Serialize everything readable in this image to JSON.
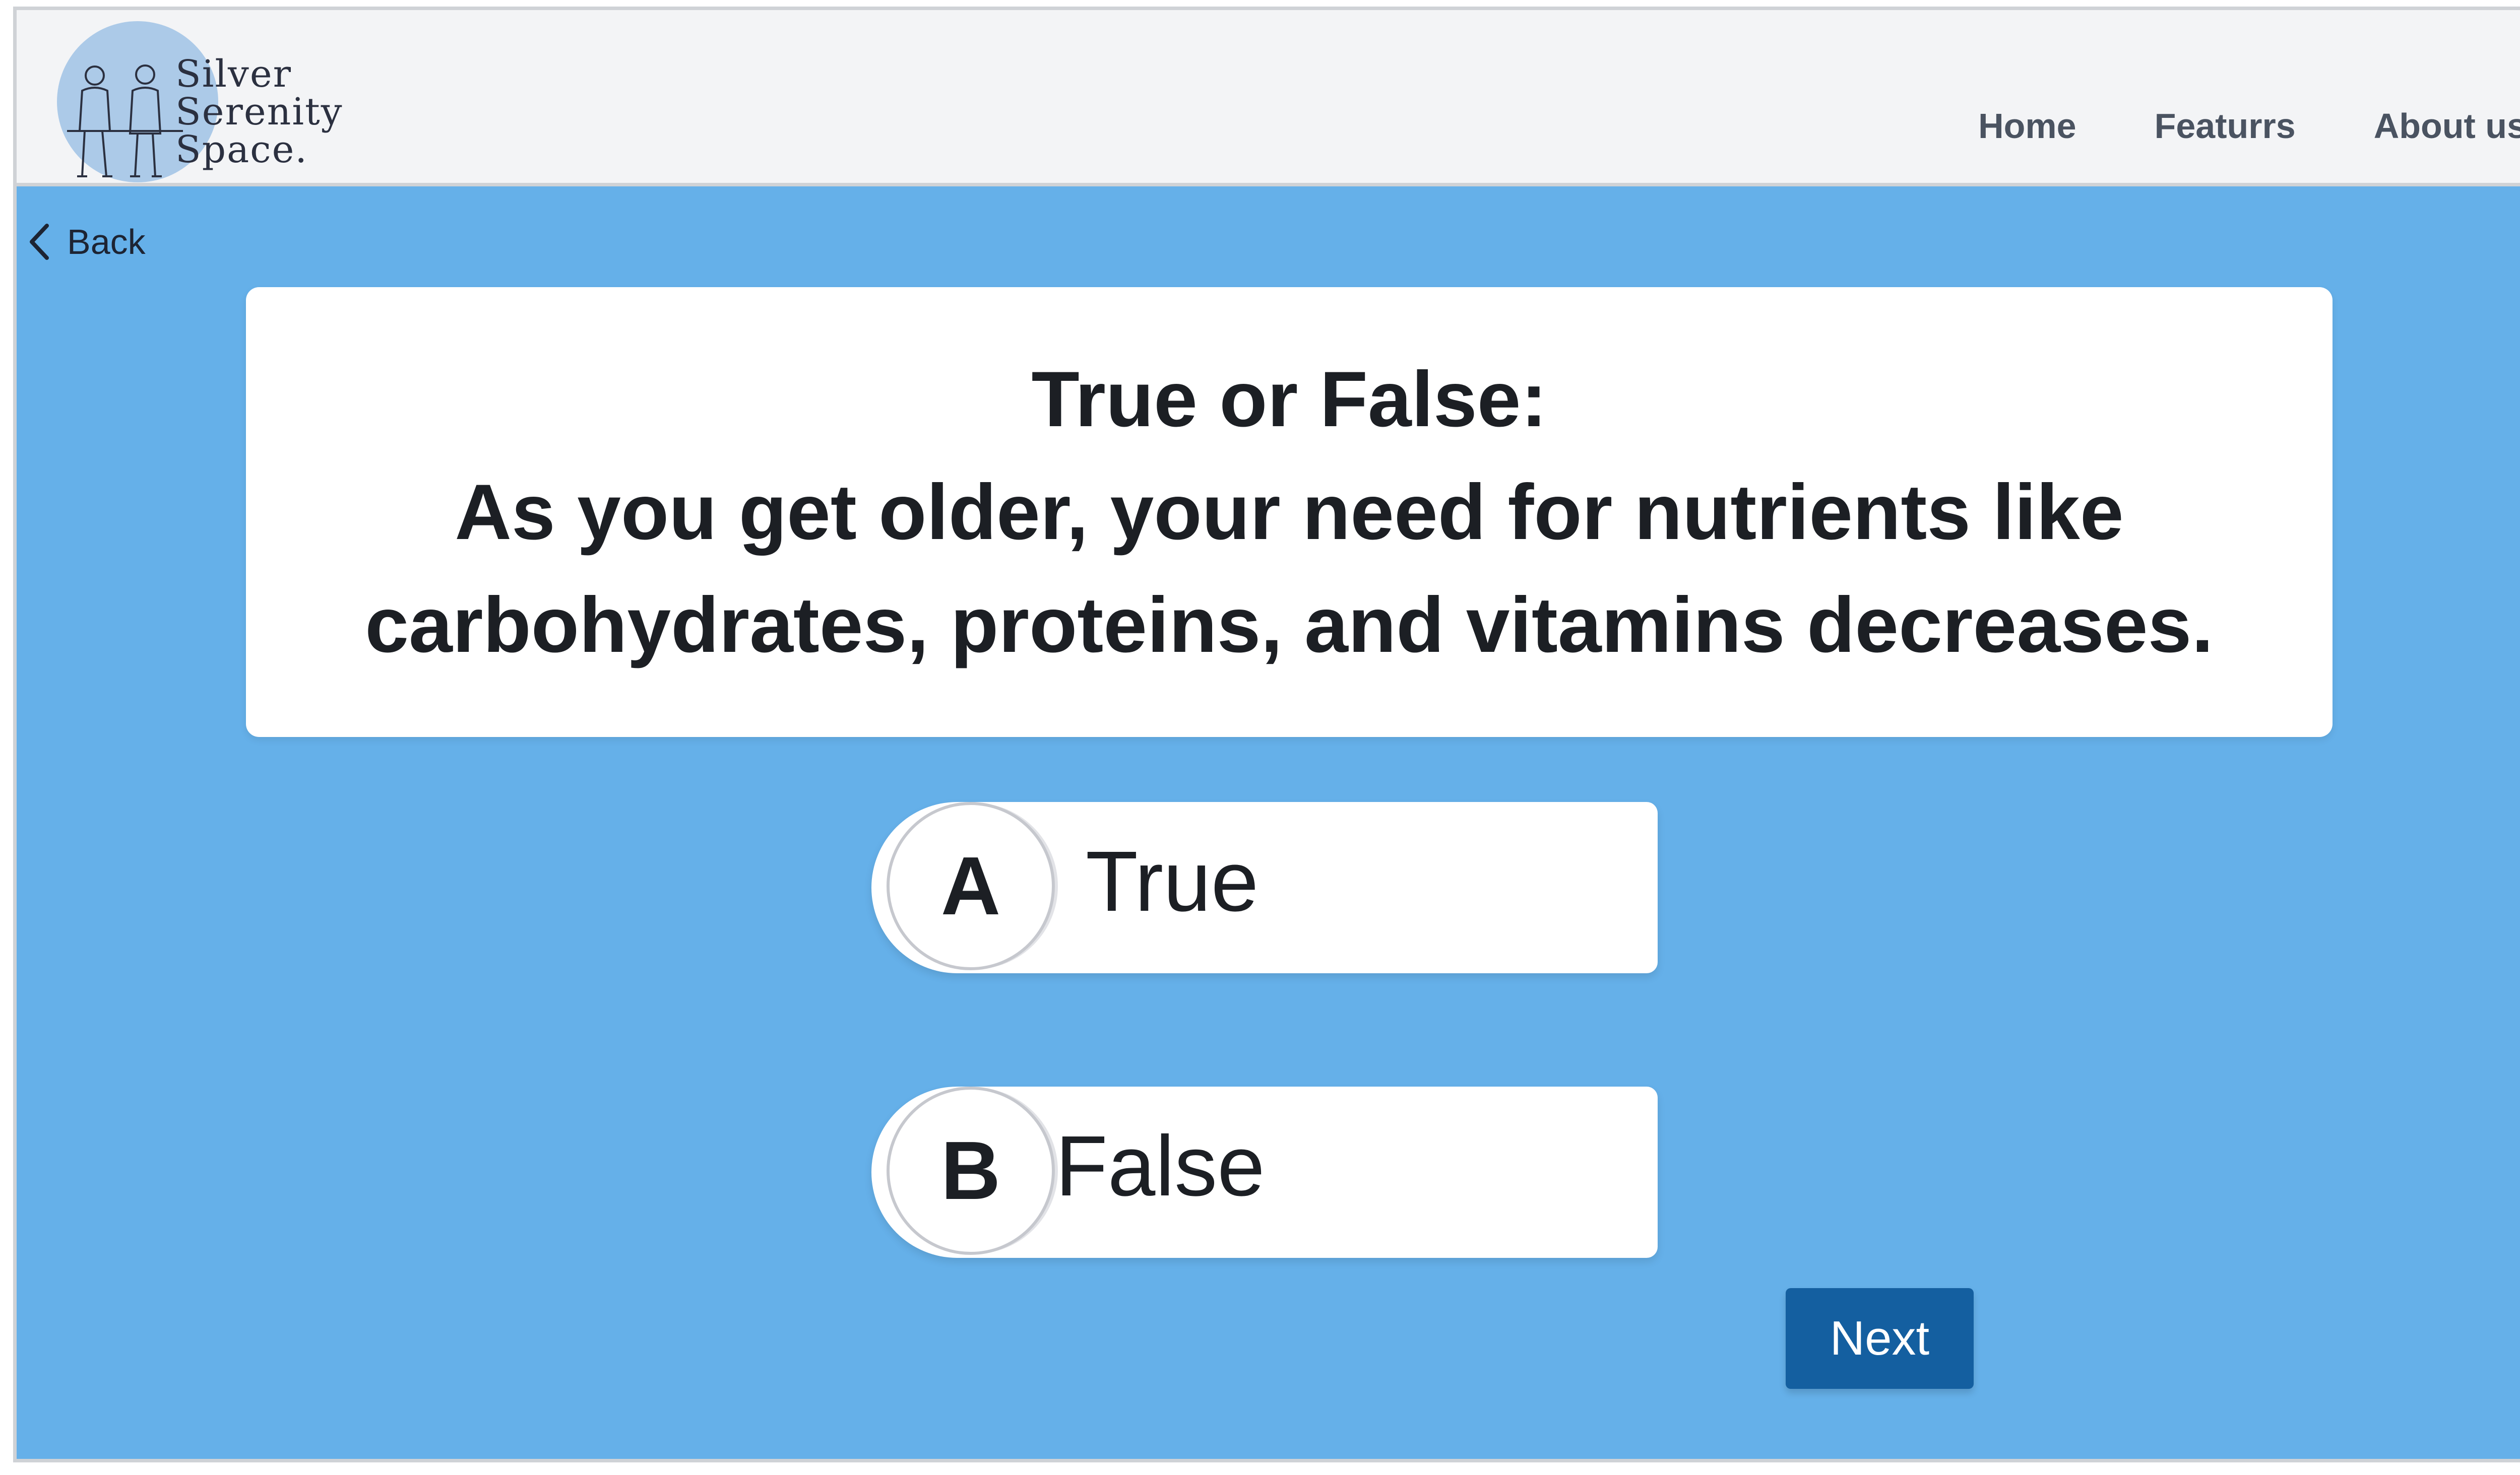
{
  "brand": {
    "lines": [
      "Silver",
      "Serenity",
      "Space."
    ],
    "logo_circle_color": "#9fc2e5"
  },
  "nav": {
    "items": [
      "Home",
      "Featurrs",
      "About us"
    ]
  },
  "back": {
    "label": "Back",
    "icon": "chevron-left-icon"
  },
  "question": {
    "title": "True or False:",
    "text": "As you get older, your need for nutrients like carbohydrates, proteins, and vitamins decreases."
  },
  "options": [
    {
      "letter": "A",
      "label": "True"
    },
    {
      "letter": "B",
      "label": "False"
    }
  ],
  "next_label": "Next",
  "colors": {
    "main_background": "#65b0e9",
    "header_background": "#f3f4f6",
    "next_button": "#145fa0"
  }
}
